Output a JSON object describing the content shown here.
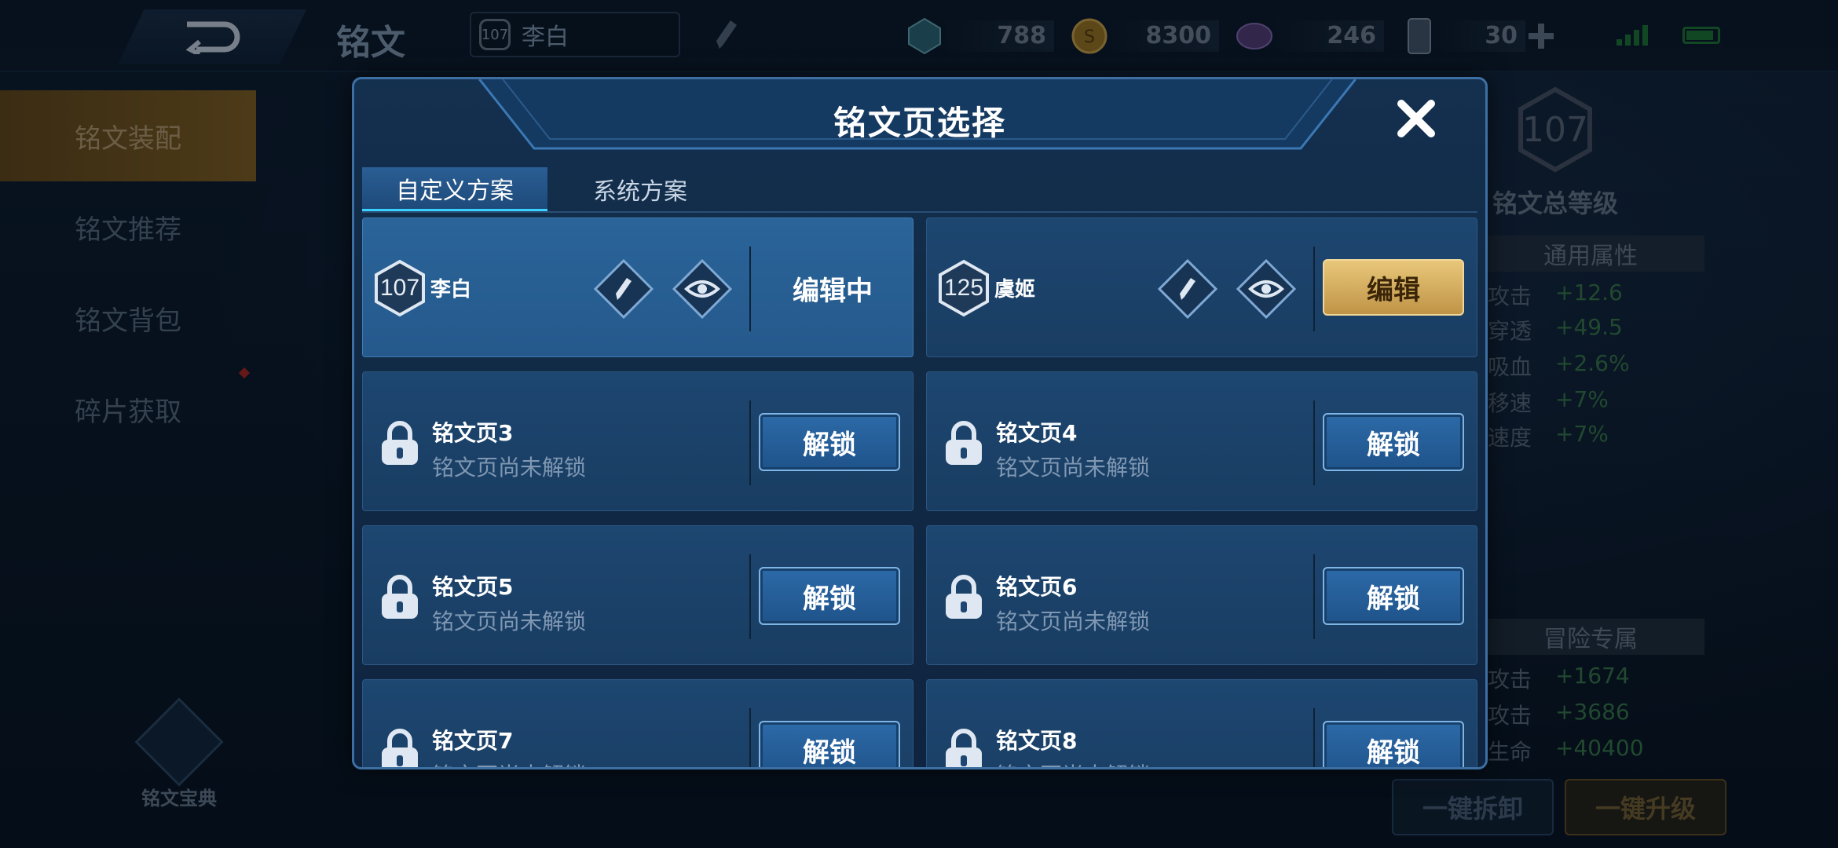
{
  "topbar": {
    "title": "铭文",
    "hero_level": "107",
    "hero_name": "李白",
    "resources": [
      {
        "icon": "gem-icon",
        "value": "788"
      },
      {
        "icon": "gold-coin-icon",
        "value": "8300"
      },
      {
        "icon": "crystal-icon",
        "value": "246"
      },
      {
        "icon": "card-icon",
        "value": "30"
      }
    ]
  },
  "sidebar": {
    "items": [
      {
        "label": "铭文装配",
        "active": true
      },
      {
        "label": "铭文推荐",
        "active": false
      },
      {
        "label": "铭文背包",
        "active": false
      },
      {
        "label": "碎片获取",
        "active": false
      }
    ],
    "codex_label": "铭文宝典"
  },
  "right_panel": {
    "total_level": "107",
    "total_label": "铭文总等级",
    "general_header": "通用属性",
    "general_attrs": [
      {
        "name": "理攻击",
        "value": "+12.6"
      },
      {
        "name": "理穿透",
        "value": "+49.5"
      },
      {
        "name": "理吸血",
        "value": "+2.6%"
      },
      {
        "name": "移速",
        "value": "+7%"
      },
      {
        "name": "击速度",
        "value": "+7%"
      }
    ],
    "adventure_header": "冒险专属",
    "adventure_attrs": [
      {
        "name": "理攻击",
        "value": "+1674"
      },
      {
        "name": "术攻击",
        "value": "+3686"
      },
      {
        "name": "大生命",
        "value": "+40400"
      }
    ],
    "dismantle_label": "一键拆卸",
    "upgrade_label": "一键升级"
  },
  "modal": {
    "title": "铭文页选择",
    "tabs": [
      {
        "label": "自定义方案",
        "active": true
      },
      {
        "label": "系统方案",
        "active": false
      }
    ],
    "cards": [
      {
        "type": "hero",
        "level": "107",
        "hero": "李白",
        "action": "编辑中",
        "selected": true
      },
      {
        "type": "hero",
        "level": "125",
        "hero": "虞姬",
        "action": "编辑",
        "selected": false
      },
      {
        "type": "locked",
        "name": "铭文页3",
        "sub": "铭文页尚未解锁",
        "action": "解锁"
      },
      {
        "type": "locked",
        "name": "铭文页4",
        "sub": "铭文页尚未解锁",
        "action": "解锁"
      },
      {
        "type": "locked",
        "name": "铭文页5",
        "sub": "铭文页尚未解锁",
        "action": "解锁"
      },
      {
        "type": "locked",
        "name": "铭文页6",
        "sub": "铭文页尚未解锁",
        "action": "解锁"
      },
      {
        "type": "locked",
        "name": "铭文页7",
        "sub": "铭文页尚未解锁",
        "action": "解锁"
      },
      {
        "type": "locked",
        "name": "铭文页8",
        "sub": "铭文页尚未解锁",
        "action": "解锁"
      }
    ]
  },
  "colors": {
    "accent_blue": "#3ad0ff",
    "gold_button": "#c09447",
    "modal_bg": "#112a45",
    "positive_green": "#3b7f4a"
  }
}
